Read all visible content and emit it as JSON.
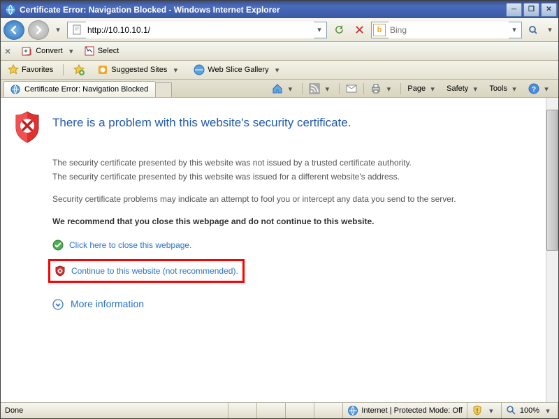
{
  "window": {
    "title": "Certificate Error: Navigation Blocked - Windows Internet Explorer"
  },
  "address": {
    "url": "http://10.10.10.1/"
  },
  "search": {
    "placeholder": "Bing",
    "engine_icon": "bing"
  },
  "convertbar": {
    "convert": "Convert",
    "select": "Select"
  },
  "favbar": {
    "favorites": "Favorites",
    "suggested": "Suggested Sites",
    "webslice": "Web Slice Gallery"
  },
  "tab": {
    "title": "Certificate Error: Navigation Blocked"
  },
  "cmd": {
    "page": "Page",
    "safety": "Safety",
    "tools": "Tools"
  },
  "error": {
    "title": "There is a problem with this website's security certificate.",
    "line1": "The security certificate presented by this website was not issued by a trusted certificate authority.",
    "line2": "The security certificate presented by this website was issued for a different website's address.",
    "line3": "Security certificate problems may indicate an attempt to fool you or intercept any data you send to the server.",
    "recommend": "We recommend that you close this webpage and do not continue to this website.",
    "close_link": "Click here to close this webpage.",
    "continue_link": "Continue to this website (not recommended).",
    "more_info": "More information"
  },
  "status": {
    "done": "Done",
    "zone": "Internet | Protected Mode: Off",
    "zoom": "100%"
  }
}
